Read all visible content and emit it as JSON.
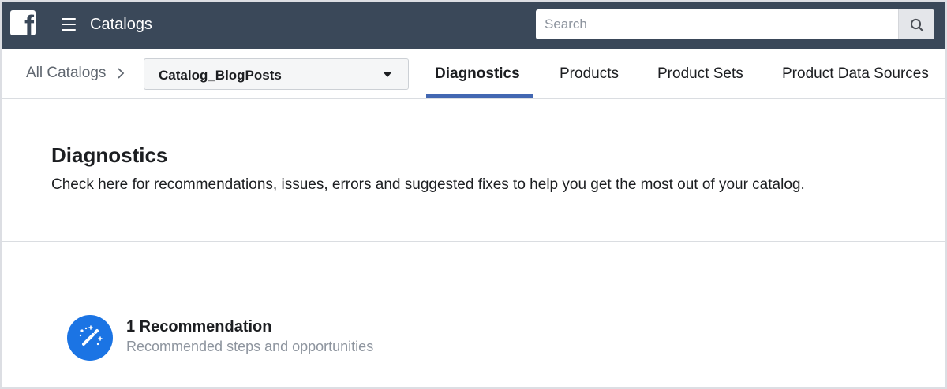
{
  "header": {
    "app_title": "Catalogs",
    "search": {
      "placeholder": "Search"
    }
  },
  "subnav": {
    "breadcrumb": "All Catalogs",
    "catalog_select": {
      "selected": "Catalog_BlogPosts"
    },
    "tabs": [
      {
        "label": "Diagnostics",
        "active": true
      },
      {
        "label": "Products",
        "active": false
      },
      {
        "label": "Product Sets",
        "active": false
      },
      {
        "label": "Product Data Sources",
        "active": false
      }
    ]
  },
  "page": {
    "title": "Diagnostics",
    "description": "Check here for recommendations, issues, errors and suggested fixes to help you get the most out of your catalog."
  },
  "recommendation": {
    "title": "1 Recommendation",
    "subtitle": "Recommended steps and opportunities",
    "icon": "magic-wand-icon"
  },
  "colors": {
    "topbar": "#3a4859",
    "accent": "#4267b2",
    "recommendation_icon_bg": "#1b74e4"
  }
}
